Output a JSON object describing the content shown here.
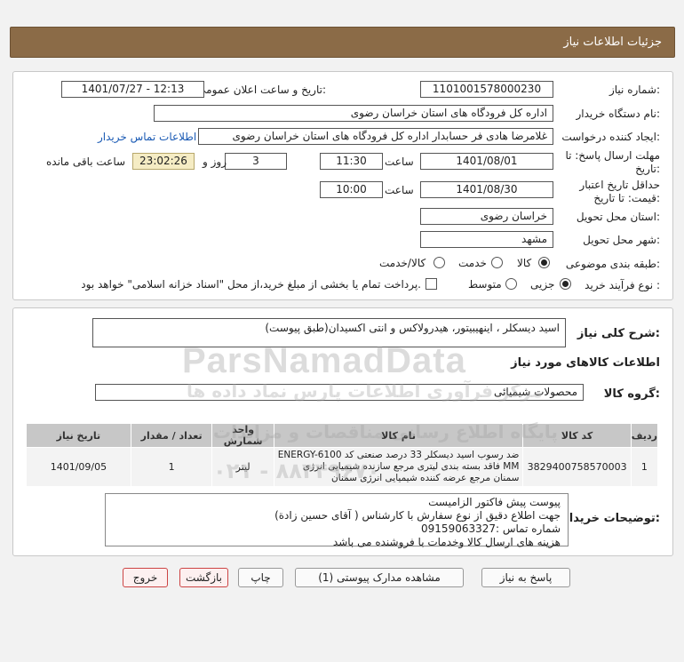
{
  "header": {
    "title": "جزئیات اطلاعات نیاز"
  },
  "form": {
    "need_number_label": "شماره نیاز:",
    "need_number": "1101001578000230",
    "announce_label": "تاریخ و ساعت اعلان عمومی:",
    "announce_value": "1401/07/27 - 12:13",
    "buyer_org_label": "نام دستگاه خریدار:",
    "buyer_org": "اداره کل فرودگاه های استان خراسان رضوی",
    "creator_label": "ایجاد کننده درخواست:",
    "creator": "غلامرضا هادی فر حسابدار اداره کل فرودگاه های استان خراسان رضوی",
    "contact_link": "اطلاعات تماس خریدار",
    "deadline_label_1": "مهلت ارسال پاسخ: تا",
    "deadline_label_2": "تاریخ:",
    "deadline_date": "1401/08/01",
    "time_label": "ساعت",
    "deadline_time": "11:30",
    "days_value": "3",
    "days_label": "روز و",
    "remaining_time": "23:02:26",
    "remaining_label": "ساعت باقی مانده",
    "validity_label_1": "حداقل تاریخ اعتبار",
    "validity_label_2": "قیمت: تا تاریخ:",
    "validity_date": "1401/08/30",
    "validity_time": "10:00",
    "province_label": "استان محل تحویل:",
    "province": "خراسان رضوی",
    "city_label": "شهر محل تحویل:",
    "city": "مشهد",
    "category_label": "طبقه بندی موضوعی:",
    "category_options": [
      "کالا",
      "خدمت",
      "کالا/خدمت"
    ],
    "process_label": "نوع فرآیند خرید :",
    "process_options": [
      "جزیی",
      "متوسط"
    ],
    "payment_note": "پرداخت تمام یا بخشی از مبلغ خرید،از محل \"اسناد خزانه اسلامی\" خواهد بود."
  },
  "summary": {
    "label": "شرح کلی نیاز:",
    "value": "اسید دیسکلر ، اینهیبیتور، هیدرولاکس و انتی اکسیدان(طبق پیوست)"
  },
  "goods": {
    "section_title": "اطلاعات کالاهای مورد نیاز",
    "group_label": "گروه کالا:",
    "group_value": "محصولات شیمیائی",
    "columns": [
      "ردیف",
      "کد کالا",
      "نام کالا",
      "واحد شمارش",
      "تعداد / مقدار",
      "تاریخ نیاز"
    ],
    "rows": [
      {
        "index": "1",
        "code": "3829400758570003",
        "name_lines": [
          "ضد رسوب اسید دیسکلر 33 درصد صنعتی کد ENERGY-6100",
          "MM فاقد بسته بندی لیتری مرجع سازنده شیمیایی انرژی",
          "سمنان مرجع عرضه کننده شیمیایی انرژی سمنان"
        ],
        "unit": "لیتر",
        "qty": "1",
        "date": "1401/09/05"
      }
    ]
  },
  "notes": {
    "label": "توضیحات خریدار:",
    "lines": [
      "پیوست پیش فاکتور الزامیست",
      "جهت اطلاع دقیق از نوع سفارش با کارشناس   ( آقای حسین زادة)",
      "شماره تماس :09159063327",
      "هزینه های ارسال کالا وخدمات با فروشنده می باشد"
    ]
  },
  "buttons": {
    "reply": "پاسخ به نیاز",
    "attachments": "مشاهده مدارک پیوستی (1)",
    "print": "چاپ",
    "back": "بازگشت",
    "exit": "خروج"
  },
  "watermark": {
    "brand": "ParsNamadData",
    "line1": "مرکز فرآوری اطلاعات پارس نماد داده ها",
    "line2": "پایگاه اطلاع رسانی مناقصات و مزایدات",
    "phone": "۰۲۱ - ۸۸۳۴۹۶۷۰"
  }
}
